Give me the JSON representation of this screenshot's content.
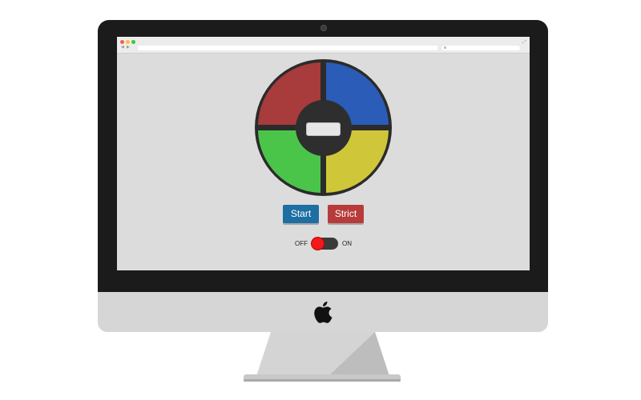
{
  "browser": {
    "url": "",
    "search_placeholder": ""
  },
  "game": {
    "quadrants": [
      {
        "name": "top-left",
        "color": "#a83b3b"
      },
      {
        "name": "top-right",
        "color": "#2a5cb8"
      },
      {
        "name": "bottom-left",
        "color": "#4ac54a"
      },
      {
        "name": "bottom-right",
        "color": "#cfc63a"
      }
    ],
    "count": "",
    "start_label": "Start",
    "strict_label": "Strict",
    "power": {
      "off_label": "OFF",
      "on_label": "ON",
      "state": "off"
    }
  },
  "colors": {
    "start_button": "#1d6ea3",
    "strict_button": "#b83b3b",
    "toggle_knob": "#f01a1a",
    "monitor_bezel": "#1b1b1b",
    "screen_bg": "#dcdcdc"
  },
  "icons": [
    "apple-icon",
    "webcam-icon",
    "search-icon",
    "expand-icon",
    "back-arrow-icon",
    "forward-arrow-icon"
  ]
}
